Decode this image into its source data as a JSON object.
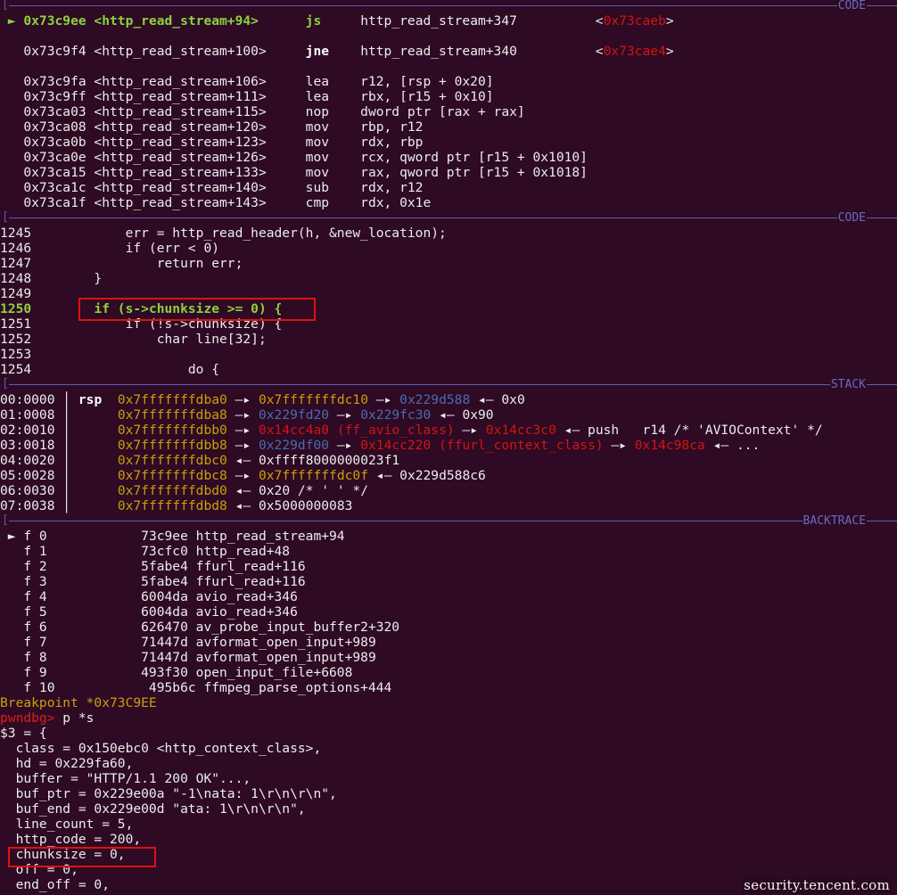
{
  "watermark": "security.tencent.com",
  "lines": [
    {
      "header": "CODE"
    },
    {
      "segs": [
        {
          "t": " ► ",
          "c": "g"
        },
        {
          "t": "0x73c9ee <http_read_stream+94>      ",
          "c": "gb"
        },
        {
          "t": "js     ",
          "c": "gb"
        },
        {
          "t": "http_read_stream+347          ",
          "c": "w"
        },
        {
          "t": "<",
          "c": "w"
        },
        {
          "t": "0x73caeb",
          "c": "r"
        },
        {
          "t": ">",
          "c": "w"
        }
      ]
    },
    {
      "segs": []
    },
    {
      "segs": [
        {
          "t": "   0x73c9f4 <http_read_stream+100>     ",
          "c": "w"
        },
        {
          "t": "jne    ",
          "c": "wb"
        },
        {
          "t": "http_read_stream+340          ",
          "c": "w"
        },
        {
          "t": "<",
          "c": "w"
        },
        {
          "t": "0x73cae4",
          "c": "r"
        },
        {
          "t": ">",
          "c": "w"
        }
      ]
    },
    {
      "segs": []
    },
    {
      "segs": [
        {
          "t": "   0x73c9fa <http_read_stream+106>     lea    r12, [rsp + 0x20]",
          "c": "w"
        }
      ]
    },
    {
      "segs": [
        {
          "t": "   0x73c9ff <http_read_stream+111>     lea    rbx, [r15 + 0x10]",
          "c": "w"
        }
      ]
    },
    {
      "segs": [
        {
          "t": "   0x73ca03 <http_read_stream+115>     nop    dword ptr [rax + rax]",
          "c": "w"
        }
      ]
    },
    {
      "segs": [
        {
          "t": "   0x73ca08 <http_read_stream+120>     mov    rbp, r12",
          "c": "w"
        }
      ]
    },
    {
      "segs": [
        {
          "t": "   0x73ca0b <http_read_stream+123>     mov    rdx, rbp",
          "c": "w"
        }
      ]
    },
    {
      "segs": [
        {
          "t": "   0x73ca0e <http_read_stream+126>     mov    rcx, qword ptr [r15 + 0x1010]",
          "c": "w"
        }
      ]
    },
    {
      "segs": [
        {
          "t": "   0x73ca15 <http_read_stream+133>     mov    rax, qword ptr [r15 + 0x1018]",
          "c": "w"
        }
      ]
    },
    {
      "segs": [
        {
          "t": "   0x73ca1c <http_read_stream+140>     sub    rdx, r12",
          "c": "w"
        }
      ]
    },
    {
      "segs": [
        {
          "t": "   0x73ca1f <http_read_stream+143>     cmp    rdx, 0x1e",
          "c": "w"
        }
      ]
    },
    {
      "header": "CODE"
    },
    {
      "segs": [
        {
          "t": "1245            err = http_read_header(h, &new_location);",
          "c": "w"
        }
      ]
    },
    {
      "segs": [
        {
          "t": "1246            if (err < 0)",
          "c": "w"
        }
      ]
    },
    {
      "segs": [
        {
          "t": "1247                return err;",
          "c": "w"
        }
      ]
    },
    {
      "segs": [
        {
          "t": "1248        }",
          "c": "w"
        }
      ]
    },
    {
      "segs": [
        {
          "t": "1249",
          "c": "w"
        }
      ]
    },
    {
      "segs": [
        {
          "t": "1250",
          "c": "gb"
        },
        {
          "t": "        if (s->chunksize >= 0) {",
          "c": "gb"
        }
      ]
    },
    {
      "segs": [
        {
          "t": "1251            if (!s->chunksize) {",
          "c": "w"
        }
      ]
    },
    {
      "segs": [
        {
          "t": "1252                char line[32];",
          "c": "w"
        }
      ]
    },
    {
      "segs": [
        {
          "t": "1253",
          "c": "w"
        }
      ]
    },
    {
      "segs": [
        {
          "t": "1254                    do {",
          "c": "w"
        }
      ]
    },
    {
      "header": "STACK"
    },
    {
      "segs": [
        {
          "t": "00:0000 ",
          "c": "w"
        },
        {
          "t": "│ ",
          "c": "bar"
        },
        {
          "t": "rsp  ",
          "c": "wb"
        },
        {
          "t": "0x7fffffffdba0",
          "c": "y"
        },
        {
          "t": " —▸ ",
          "c": "w"
        },
        {
          "t": "0x7fffffffdc10",
          "c": "y"
        },
        {
          "t": " —▸ ",
          "c": "w"
        },
        {
          "t": "0x229d588",
          "c": "b"
        },
        {
          "t": " ◂— ",
          "c": "w"
        },
        {
          "t": "0x0",
          "c": "w"
        }
      ]
    },
    {
      "segs": [
        {
          "t": "01:0008 ",
          "c": "w"
        },
        {
          "t": "│      ",
          "c": "bar"
        },
        {
          "t": "0x7fffffffdba8",
          "c": "y"
        },
        {
          "t": " —▸ ",
          "c": "w"
        },
        {
          "t": "0x229fd20",
          "c": "b"
        },
        {
          "t": " —▸ ",
          "c": "w"
        },
        {
          "t": "0x229fc30",
          "c": "b"
        },
        {
          "t": " ◂— ",
          "c": "w"
        },
        {
          "t": "0x90",
          "c": "w"
        }
      ]
    },
    {
      "segs": [
        {
          "t": "02:0010 ",
          "c": "w"
        },
        {
          "t": "│      ",
          "c": "bar"
        },
        {
          "t": "0x7fffffffdbb0",
          "c": "y"
        },
        {
          "t": " —▸ ",
          "c": "w"
        },
        {
          "t": "0x14cc4a0 (ff_avio_class)",
          "c": "r"
        },
        {
          "t": " —▸ ",
          "c": "w"
        },
        {
          "t": "0x14cc3c0",
          "c": "r"
        },
        {
          "t": " ◂— ",
          "c": "w"
        },
        {
          "t": "push   r14 /* 'AVIOContext' */",
          "c": "w"
        }
      ]
    },
    {
      "segs": [
        {
          "t": "03:0018 ",
          "c": "w"
        },
        {
          "t": "│      ",
          "c": "bar"
        },
        {
          "t": "0x7fffffffdbb8",
          "c": "y"
        },
        {
          "t": " —▸ ",
          "c": "w"
        },
        {
          "t": "0x229df00",
          "c": "b"
        },
        {
          "t": " —▸ ",
          "c": "w"
        },
        {
          "t": "0x14cc220 (ffurl_context_class)",
          "c": "r"
        },
        {
          "t": " —▸ ",
          "c": "w"
        },
        {
          "t": "0x14c98ca",
          "c": "r"
        },
        {
          "t": " ◂— ",
          "c": "w"
        },
        {
          "t": "...",
          "c": "w"
        }
      ]
    },
    {
      "segs": [
        {
          "t": "04:0020 ",
          "c": "w"
        },
        {
          "t": "│      ",
          "c": "bar"
        },
        {
          "t": "0x7fffffffdbc0",
          "c": "y"
        },
        {
          "t": " ◂— ",
          "c": "w"
        },
        {
          "t": "0xffff8000000023f1",
          "c": "w"
        }
      ]
    },
    {
      "segs": [
        {
          "t": "05:0028 ",
          "c": "w"
        },
        {
          "t": "│      ",
          "c": "bar"
        },
        {
          "t": "0x7fffffffdbc8",
          "c": "y"
        },
        {
          "t": " —▸ ",
          "c": "w"
        },
        {
          "t": "0x7fffffffdc0f",
          "c": "y"
        },
        {
          "t": " ◂— ",
          "c": "w"
        },
        {
          "t": "0x229d588c6",
          "c": "w"
        }
      ]
    },
    {
      "segs": [
        {
          "t": "06:0030 ",
          "c": "w"
        },
        {
          "t": "│      ",
          "c": "bar"
        },
        {
          "t": "0x7fffffffdbd0",
          "c": "y"
        },
        {
          "t": " ◂— ",
          "c": "w"
        },
        {
          "t": "0x20 /* ' ' */",
          "c": "w"
        }
      ]
    },
    {
      "segs": [
        {
          "t": "07:0038 ",
          "c": "w"
        },
        {
          "t": "│      ",
          "c": "bar"
        },
        {
          "t": "0x7fffffffdbd8",
          "c": "y"
        },
        {
          "t": " ◂— ",
          "c": "w"
        },
        {
          "t": "0x5000000083",
          "c": "w"
        }
      ]
    },
    {
      "header": "BACKTRACE"
    },
    {
      "segs": [
        {
          "t": " ► ",
          "c": "w"
        },
        {
          "t": "f 0            73c9ee http_read_stream+94",
          "c": "w"
        }
      ]
    },
    {
      "segs": [
        {
          "t": "   f 1            73cfc0 http_read+48",
          "c": "w"
        }
      ]
    },
    {
      "segs": [
        {
          "t": "   f 2            5fabe4 ffurl_read+116",
          "c": "w"
        }
      ]
    },
    {
      "segs": [
        {
          "t": "   f 3            5fabe4 ffurl_read+116",
          "c": "w"
        }
      ]
    },
    {
      "segs": [
        {
          "t": "   f 4            6004da avio_read+346",
          "c": "w"
        }
      ]
    },
    {
      "segs": [
        {
          "t": "   f 5            6004da avio_read+346",
          "c": "w"
        }
      ]
    },
    {
      "segs": [
        {
          "t": "   f 6            626470 av_probe_input_buffer2+320",
          "c": "w"
        }
      ]
    },
    {
      "segs": [
        {
          "t": "   f 7            71447d avformat_open_input+989",
          "c": "w"
        }
      ]
    },
    {
      "segs": [
        {
          "t": "   f 8            71447d avformat_open_input+989",
          "c": "w"
        }
      ]
    },
    {
      "segs": [
        {
          "t": "   f 9            493f30 open_input_file+6608",
          "c": "w"
        }
      ]
    },
    {
      "segs": [
        {
          "t": "   f 10            495b6c ffmpeg_parse_options+444",
          "c": "w"
        }
      ]
    },
    {
      "segs": [
        {
          "t": "Breakpoint *0x73C9EE",
          "c": "y"
        }
      ]
    },
    {
      "segs": [
        {
          "t": "pwndbg> ",
          "c": "pr"
        },
        {
          "t": "p *s",
          "c": "w"
        }
      ]
    },
    {
      "segs": [
        {
          "t": "$3 = {",
          "c": "w"
        }
      ]
    },
    {
      "segs": [
        {
          "t": "  class = 0x150ebc0 <http_context_class>,",
          "c": "w"
        }
      ]
    },
    {
      "segs": [
        {
          "t": "  hd = 0x229fa60,",
          "c": "w"
        }
      ]
    },
    {
      "segs": [
        {
          "t": "  buffer = \"HTTP/1.1 200 OK\"...,",
          "c": "w"
        }
      ]
    },
    {
      "segs": [
        {
          "t": "  buf_ptr = 0x229e00a \"-1\\nata: 1\\r\\n\\r\\n\",",
          "c": "w"
        }
      ]
    },
    {
      "segs": [
        {
          "t": "  buf_end = 0x229e00d \"ata: 1\\r\\n\\r\\n\",",
          "c": "w"
        }
      ]
    },
    {
      "segs": [
        {
          "t": "  line_count = 5,",
          "c": "w"
        }
      ]
    },
    {
      "segs": [
        {
          "t": "  http_code = 200,",
          "c": "w"
        }
      ]
    },
    {
      "segs": [
        {
          "t": "  chunksize = 0,",
          "c": "w"
        }
      ]
    },
    {
      "segs": [
        {
          "t": "  off = 0,",
          "c": "w"
        }
      ]
    },
    {
      "segs": [
        {
          "t": "  end_off = 0,",
          "c": "w"
        }
      ]
    }
  ]
}
